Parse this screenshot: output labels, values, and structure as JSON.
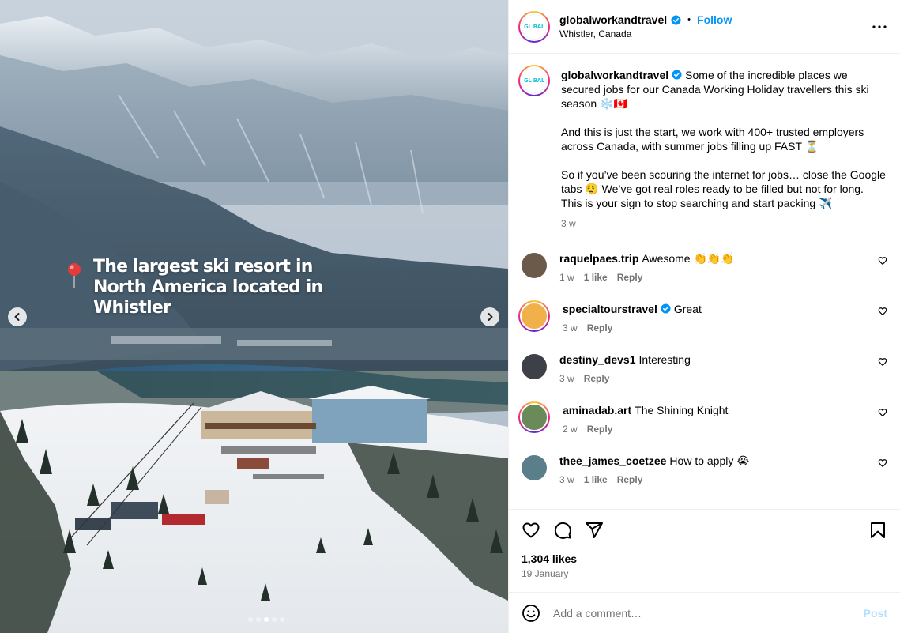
{
  "post": {
    "author": "globalworkandtravel",
    "avatar_text": "GL BAL",
    "location": "Whistler, Canada",
    "follow_label": "Follow",
    "separator": "•",
    "caption": "Some of the incredible places we secured jobs for our Canada Working Holiday travellers this ski season ❄️🇨🇦\n\nAnd this is just the start, we work with 400+ trusted employers across Canada, with summer jobs filling up FAST ⏳\n\nSo if you’ve been scouring the internet for jobs… close the Google tabs 😮‍💨 We’ve got real roles ready to be filled but not for long.\nThis is your sign to stop searching and start packing ✈️",
    "caption_age": "3 w",
    "image_overlay_text": "The largest ski resort in North America located in Whistler",
    "carousel": {
      "total_dots": 5,
      "active_index": 2
    }
  },
  "comments": [
    {
      "user": "raquelpaes.trip",
      "verified": false,
      "text": "Awesome 👏👏👏",
      "age": "1 w",
      "likes": "1 like",
      "reply": "Reply",
      "avatar_color": "#6b5a4a",
      "ring": false
    },
    {
      "user": "specialtourstravel",
      "verified": true,
      "text": "Great",
      "age": "3 w",
      "likes": "",
      "reply": "Reply",
      "avatar_color": "#f2b04a",
      "ring": true
    },
    {
      "user": "destiny_devs1",
      "verified": false,
      "text": "Interesting",
      "age": "3 w",
      "likes": "",
      "reply": "Reply",
      "avatar_color": "#3d4047",
      "ring": false
    },
    {
      "user": "aminadab.art",
      "verified": false,
      "text": "The Shining Knight",
      "age": "2 w",
      "likes": "",
      "reply": "Reply",
      "avatar_color": "#6a8a5a",
      "ring": true
    },
    {
      "user": "thee_james_coetzee",
      "verified": false,
      "text": "How to apply 😭",
      "age": "3 w",
      "likes": "1 like",
      "reply": "Reply",
      "avatar_color": "#5a7e8a",
      "ring": false
    }
  ],
  "engagement": {
    "likes": "1,304 likes",
    "date": "19 January"
  },
  "composer": {
    "placeholder": "Add a comment…",
    "post_label": "Post"
  },
  "colors": {
    "accent": "#0095f6",
    "muted": "#737373",
    "post_disabled": "#b2dffc"
  },
  "icons": [
    "pin-icon",
    "chevron-left-icon",
    "chevron-right-icon",
    "verified-icon",
    "more-icon",
    "heart-icon",
    "comment-icon",
    "share-icon",
    "bookmark-icon",
    "emoji-icon"
  ]
}
